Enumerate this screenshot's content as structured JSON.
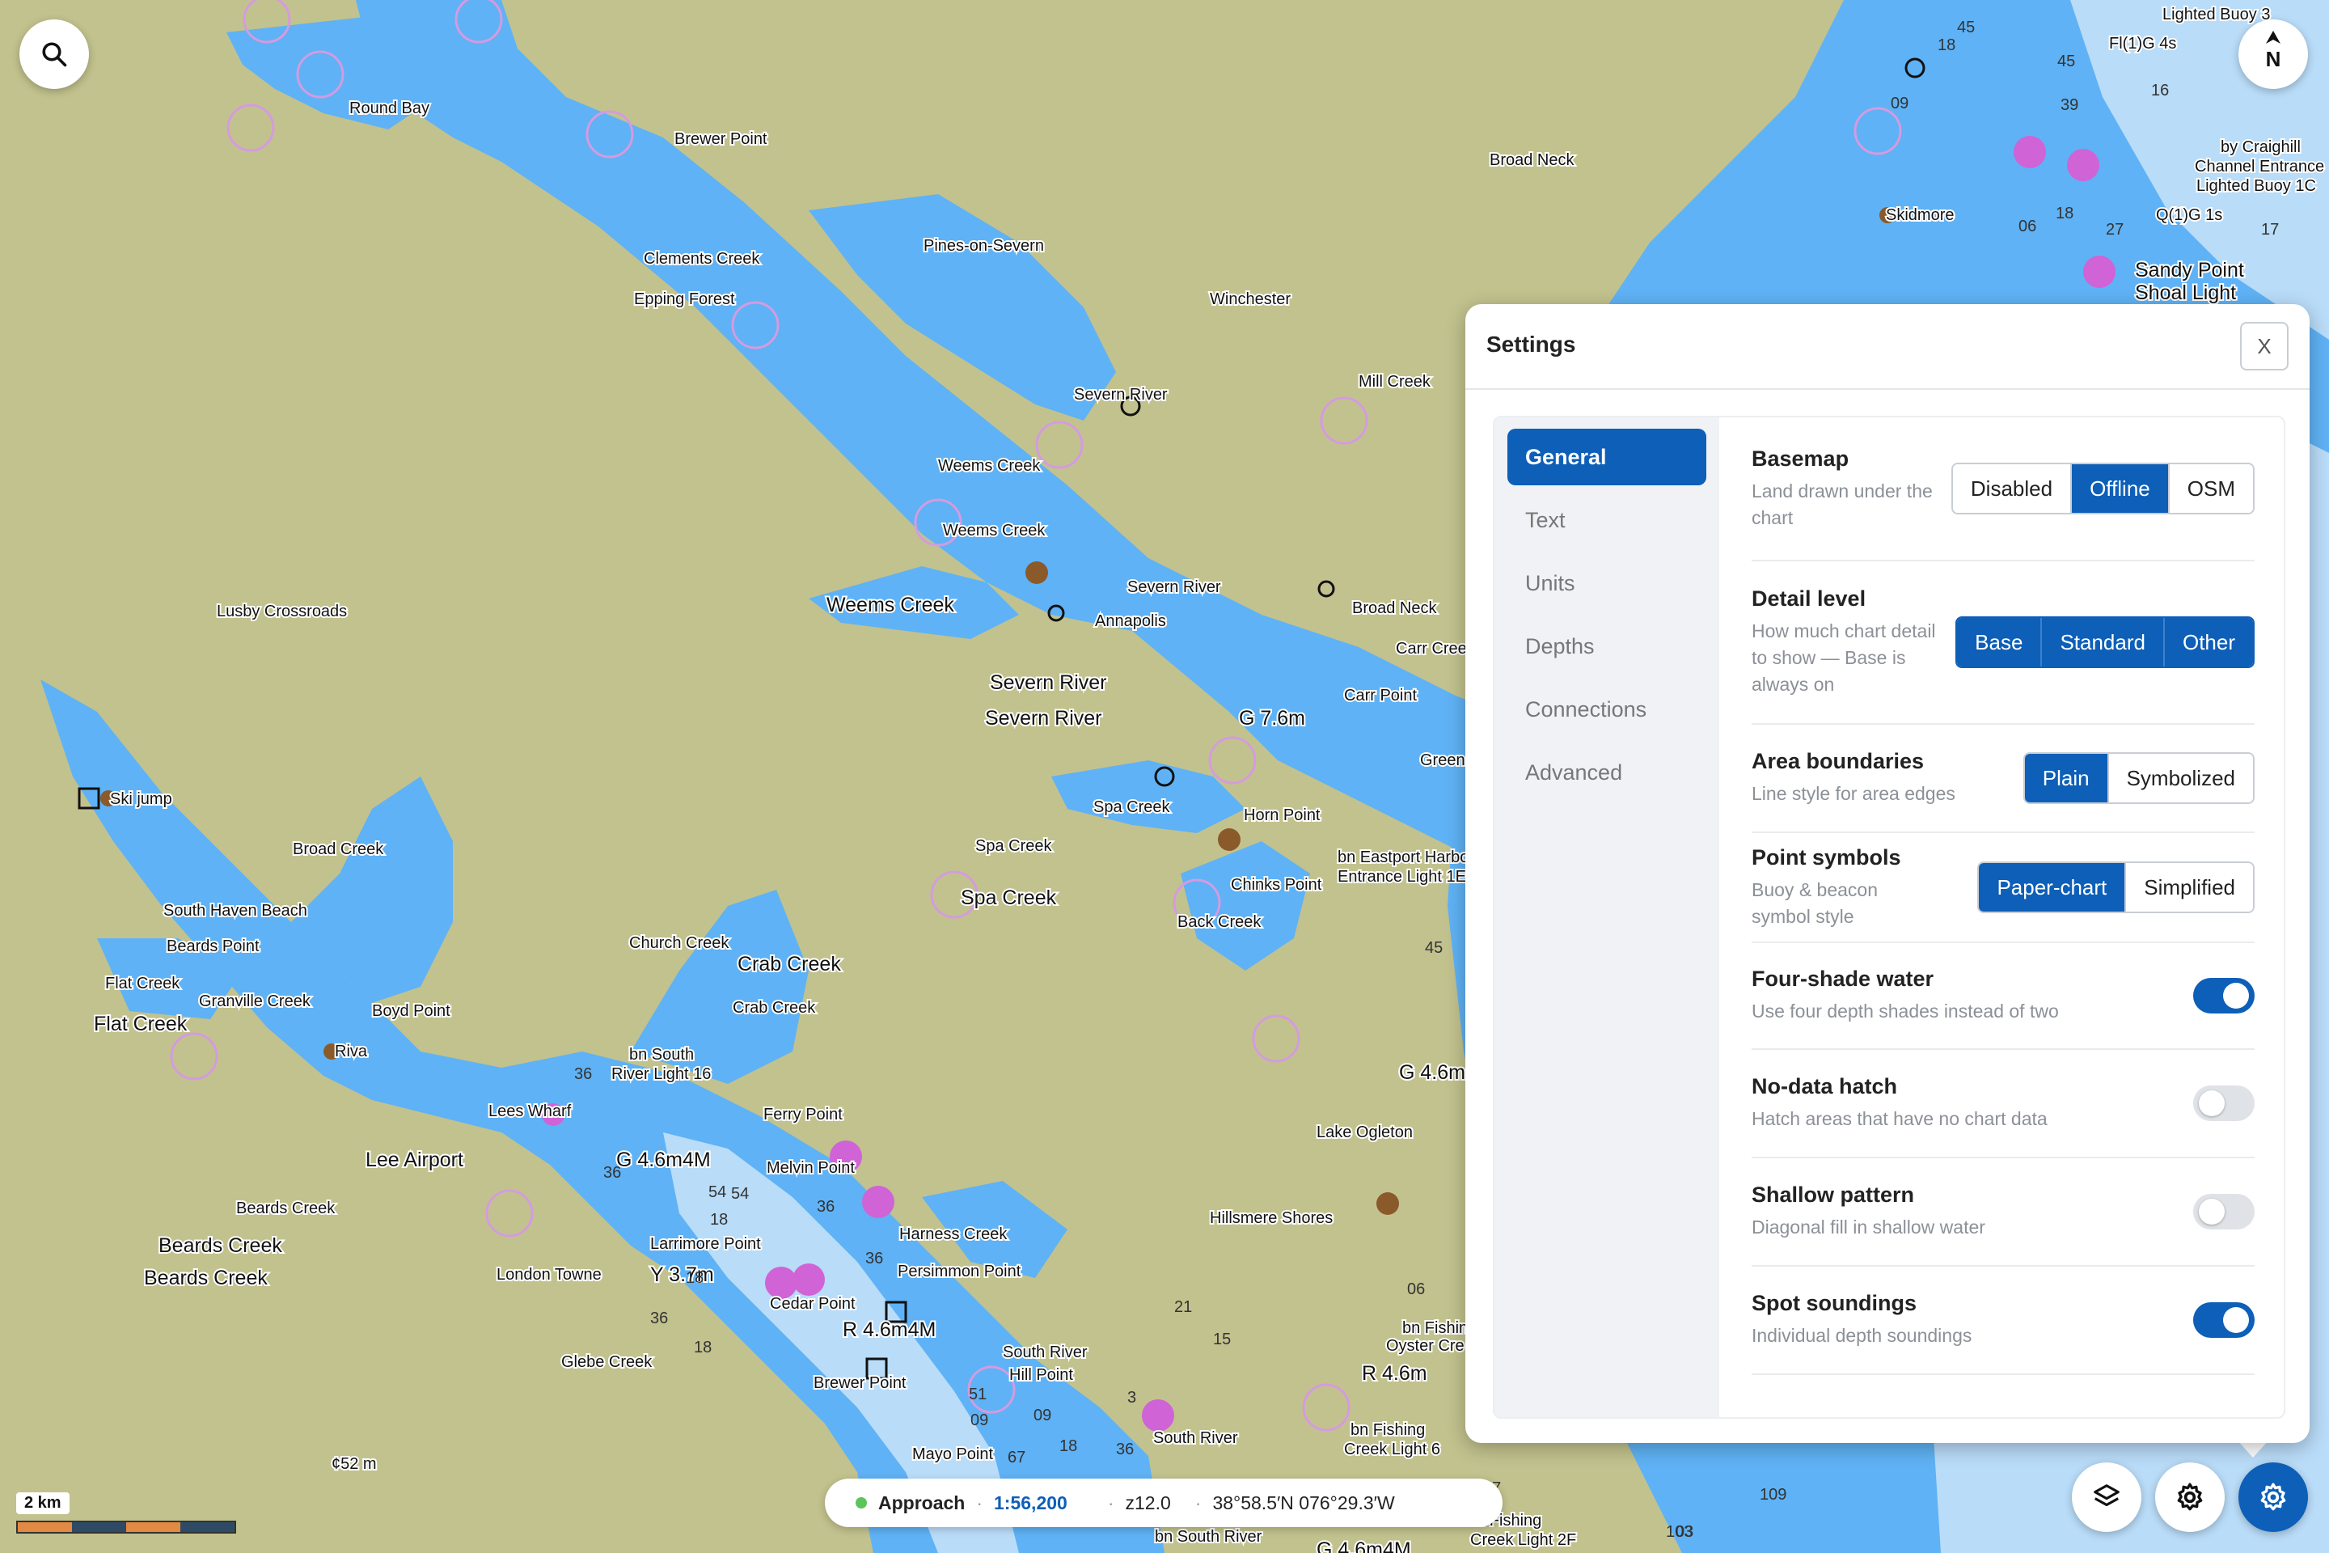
{
  "map": {
    "labels": [
      {
        "text": "Round Bay",
        "size": "s"
      },
      {
        "text": "Brewer Point",
        "size": "s"
      },
      {
        "text": "Clements Creek",
        "size": "s"
      },
      {
        "text": "Epping Forest",
        "size": "s"
      },
      {
        "text": "Pines-on-Severn",
        "size": "s"
      },
      {
        "text": "Winchester",
        "size": "s"
      },
      {
        "text": "Broad Neck",
        "size": "s"
      },
      {
        "text": "Skidmore",
        "size": "s"
      },
      {
        "text": "Severn River",
        "size": "s"
      },
      {
        "text": "Mill Creek",
        "size": "s"
      },
      {
        "text": "Weems Creek",
        "size": "s"
      },
      {
        "text": "Weems Creek",
        "size": "s"
      },
      {
        "text": "Weems Creek",
        "size": "l"
      },
      {
        "text": "Lusby Crossroads",
        "size": "s"
      },
      {
        "text": "Severn River",
        "size": "s"
      },
      {
        "text": "Annapolis",
        "size": "s"
      },
      {
        "text": "Broad Neck",
        "size": "s"
      },
      {
        "text": "Carr Creek",
        "size": "s"
      },
      {
        "text": "Carr Point",
        "size": "s"
      },
      {
        "text": "Severn River",
        "size": "l"
      },
      {
        "text": "Severn River",
        "size": "l"
      },
      {
        "text": "G 7.6m",
        "size": "l"
      },
      {
        "text": "Ski jump",
        "size": "s"
      },
      {
        "text": "Broad Creek",
        "size": "s"
      },
      {
        "text": "Spa Creek",
        "size": "s"
      },
      {
        "text": "Spa Creek",
        "size": "s"
      },
      {
        "text": "Spa Creek",
        "size": "l"
      },
      {
        "text": "Horn Point",
        "size": "s"
      },
      {
        "text": "bn Eastport Harbor",
        "size": "s"
      },
      {
        "text": "Entrance Light 1E",
        "size": "s"
      },
      {
        "text": "Chinks Point",
        "size": "s"
      },
      {
        "text": "Back Creek",
        "size": "s"
      },
      {
        "text": "South Haven Beach",
        "size": "s"
      },
      {
        "text": "Beards Point",
        "size": "s"
      },
      {
        "text": "Church Creek",
        "size": "s"
      },
      {
        "text": "Crab Creek",
        "size": "l"
      },
      {
        "text": "Crab Creek",
        "size": "s"
      },
      {
        "text": "Flat Creek",
        "size": "s"
      },
      {
        "text": "Flat Creek",
        "size": "l"
      },
      {
        "text": "Granville Creek",
        "size": "s"
      },
      {
        "text": "Boyd Point",
        "size": "s"
      },
      {
        "text": "Riva",
        "size": "s"
      },
      {
        "text": "bn South",
        "size": "s"
      },
      {
        "text": "River Light 16",
        "size": "s"
      },
      {
        "text": "Lees Wharf",
        "size": "s"
      },
      {
        "text": "Ferry Point",
        "size": "s"
      },
      {
        "text": "Lee Airport",
        "size": "l"
      },
      {
        "text": "G 4.6m4M",
        "size": "l"
      },
      {
        "text": "Melvin Point",
        "size": "s"
      },
      {
        "text": "Lake Ogleton",
        "size": "s"
      },
      {
        "text": "G 4.6m",
        "size": "l"
      },
      {
        "text": "Beards Creek",
        "size": "s"
      },
      {
        "text": "Beards Creek",
        "size": "l"
      },
      {
        "text": "Beards Creek",
        "size": "l"
      },
      {
        "text": "Hillsmere Shores",
        "size": "s"
      },
      {
        "text": "Harness Creek",
        "size": "s"
      },
      {
        "text": "Larrimore Point",
        "size": "s"
      },
      {
        "text": "London Towne",
        "size": "s"
      },
      {
        "text": "Y 3.7m",
        "size": "l"
      },
      {
        "text": "Persimmon Point",
        "size": "s"
      },
      {
        "text": "Cedar Point",
        "size": "s"
      },
      {
        "text": "R 4.6m4M",
        "size": "l"
      },
      {
        "text": "Glebe Creek",
        "size": "s"
      },
      {
        "text": "Brewer Point",
        "size": "s"
      },
      {
        "text": "South River",
        "size": "s"
      },
      {
        "text": "Hill Point",
        "size": "s"
      },
      {
        "text": "South River",
        "size": "s"
      },
      {
        "text": "R 4.6m",
        "size": "l"
      },
      {
        "text": "bn Fishing",
        "size": "s"
      },
      {
        "text": "Oyster Cre",
        "size": "s"
      },
      {
        "text": "Mayo Point",
        "size": "s"
      },
      {
        "text": "bn Fishing",
        "size": "s"
      },
      {
        "text": "Creek Light 6",
        "size": "s"
      },
      {
        "text": "bn South River",
        "size": "s"
      },
      {
        "text": "bn Fishing",
        "size": "s"
      },
      {
        "text": "Creek Light 2F",
        "size": "s"
      },
      {
        "text": "G 4.6m4M",
        "size": "l"
      },
      {
        "text": "Lighted Buoy 3",
        "size": "s"
      },
      {
        "text": "Fl(1)G 4s",
        "size": "s"
      },
      {
        "text": "by Craighill",
        "size": "s"
      },
      {
        "text": "Channel Entrance",
        "size": "s"
      },
      {
        "text": "Lighted Buoy 1C",
        "size": "s"
      },
      {
        "text": "Q(1)G 1s",
        "size": "s"
      },
      {
        "text": "Sandy Point",
        "size": "l"
      },
      {
        "text": "Shoal Light",
        "size": "l"
      },
      {
        "text": "Green",
        "size": "s"
      },
      {
        "text": "G 4.6m",
        "size": "l"
      },
      {
        "text": "¢52 m",
        "size": "s"
      }
    ],
    "soundings": [
      "18",
      "45",
      "45",
      "39",
      "09",
      "16",
      "06",
      "18",
      "27",
      "17",
      "54",
      "36",
      "36",
      "18",
      "54",
      "36",
      "18",
      "36",
      "18",
      "15",
      "21",
      "06",
      "67",
      "03",
      "67",
      "09",
      "36",
      "51",
      "18",
      "09",
      "103",
      "109",
      "45",
      "3",
      "36",
      "67",
      "06",
      "36"
    ],
    "colors": {
      "land": "#c2c28e",
      "shallow": "#5fb2f5",
      "deep": "#b9dcf8",
      "restricted": "#d063d6"
    }
  },
  "controls": {
    "search_icon": "search-icon",
    "north_label": "N",
    "layers_icon": "layers-icon",
    "gear_icon": "gear-icon",
    "settings_icon": "settings-cog-icon"
  },
  "scale": {
    "label": "2 km",
    "segments": [
      "#e28a43",
      "#2f4a64",
      "#e28a43",
      "#2f4a64"
    ]
  },
  "status": {
    "dot_color": "#5cc45c",
    "mode": "Approach",
    "sep": "·",
    "scale": "1:56,200",
    "zoom": "z12.0",
    "coords": "38°58.5′N 076°29.3′W"
  },
  "settings": {
    "title": "Settings",
    "close_label": "X",
    "nav": [
      {
        "label": "General",
        "active": true
      },
      {
        "label": "Text",
        "active": false
      },
      {
        "label": "Units",
        "active": false
      },
      {
        "label": "Depths",
        "active": false
      },
      {
        "label": "Connections",
        "active": false
      },
      {
        "label": "Advanced",
        "active": false
      }
    ],
    "basemap": {
      "title": "Basemap",
      "desc": "Land drawn under the chart",
      "options": [
        "Disabled",
        "Offline",
        "OSM"
      ],
      "selected": "Offline"
    },
    "detail": {
      "title": "Detail level",
      "desc": "How much chart detail to show — Base is always on",
      "options": [
        "Base",
        "Standard",
        "Other"
      ],
      "selected": "all"
    },
    "boundaries": {
      "title": "Area boundaries",
      "desc": "Line style for area edges",
      "options": [
        "Plain",
        "Symbolized"
      ],
      "selected": "Plain"
    },
    "symbols": {
      "title": "Point symbols",
      "desc": "Buoy & beacon symbol style",
      "options": [
        "Paper-chart",
        "Simplified"
      ],
      "selected": "Paper-chart"
    },
    "fourshade": {
      "title": "Four-shade water",
      "desc": "Use four depth shades instead of two",
      "on": true
    },
    "nodata": {
      "title": "No-data hatch",
      "desc": "Hatch areas that have no chart data",
      "on": false
    },
    "shallow": {
      "title": "Shallow pattern",
      "desc": "Diagonal fill in shallow water",
      "on": false
    },
    "soundings": {
      "title": "Spot soundings",
      "desc": "Individual depth soundings",
      "on": true
    }
  }
}
